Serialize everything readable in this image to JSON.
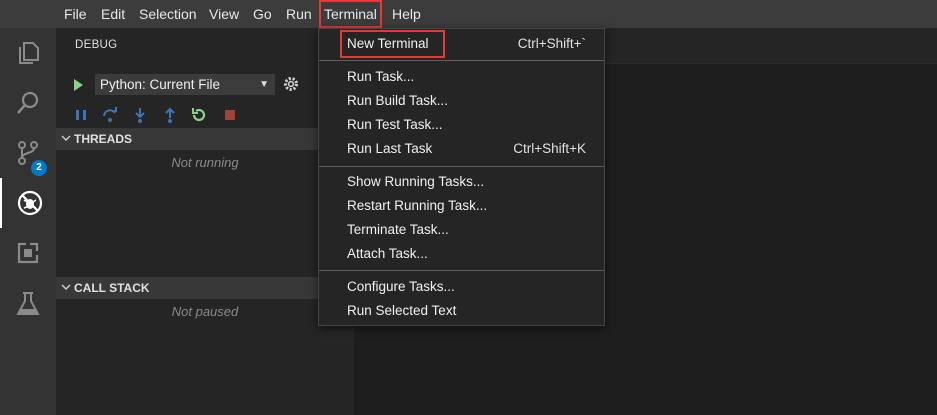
{
  "menubar": {
    "items": [
      "File",
      "Edit",
      "Selection",
      "View",
      "Go",
      "Run",
      "Terminal",
      "Help"
    ]
  },
  "activity_bar": {
    "source_control_badge": "2"
  },
  "sidebar": {
    "title": "DEBUG",
    "config_select": "Python: Current File",
    "threads": {
      "header": "THREADS",
      "status": "Not running"
    },
    "call_stack": {
      "header": "CALL STACK",
      "status": "Not paused"
    }
  },
  "terminal_menu": {
    "items": [
      {
        "label": "New Terminal",
        "shortcut": "Ctrl+Shift+`"
      },
      {
        "label": "Run Task..."
      },
      {
        "label": "Run Build Task..."
      },
      {
        "label": "Run Test Task..."
      },
      {
        "label": "Run Last Task",
        "shortcut": "Ctrl+Shift+K"
      },
      {
        "label": "Show Running Tasks..."
      },
      {
        "label": "Restart Running Task..."
      },
      {
        "label": "Terminate Task..."
      },
      {
        "label": "Attach Task..."
      },
      {
        "label": "Configure Tasks..."
      },
      {
        "label": "Run Selected Text"
      }
    ]
  },
  "colors": {
    "accent": "#007acc",
    "highlight_box": "#e53935",
    "play_green": "#89d185"
  }
}
